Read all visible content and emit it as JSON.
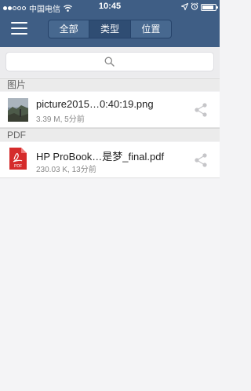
{
  "status_bar": {
    "carrier": "中国电信",
    "time": "10:45",
    "signal_bars_filled": 2,
    "signal_bars_total": 5,
    "battery_level": 0.85,
    "icons": [
      "wifi-icon",
      "location-icon",
      "alarm-icon",
      "battery-icon"
    ]
  },
  "header": {
    "menu_icon": "hamburger-menu-icon",
    "tabs": [
      {
        "label": "全部",
        "active": false
      },
      {
        "label": "类型",
        "active": true
      },
      {
        "label": "位置",
        "active": false
      }
    ],
    "accent_color": "#3f5e85"
  },
  "search": {
    "placeholder": "",
    "icon": "search-icon"
  },
  "sections": [
    {
      "header": "图片",
      "items": [
        {
          "name": "picture2015…0:40:19.png",
          "meta": "3.39 M, 5分前",
          "icon": "image-thumbnail"
        }
      ]
    },
    {
      "header": "PDF",
      "items": [
        {
          "name": "HP ProBook…是梦_final.pdf",
          "meta": "230.03 K, 13分前",
          "icon": "pdf-icon"
        }
      ]
    }
  ]
}
